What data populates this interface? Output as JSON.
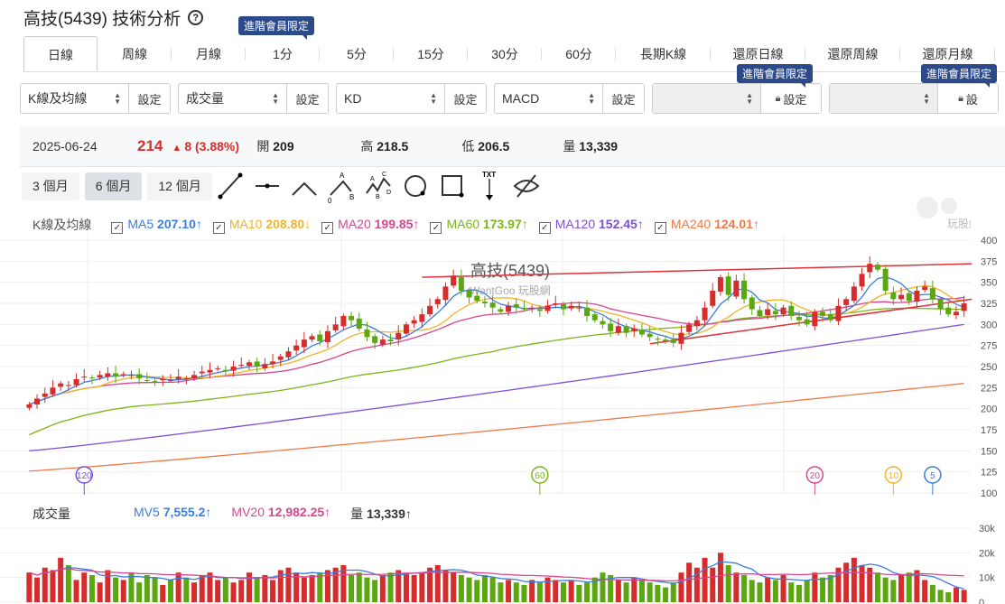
{
  "header": {
    "title": "高技(5439) 技術分析",
    "help_icon": "?"
  },
  "tabs": [
    "日線",
    "周線",
    "月線",
    "1分",
    "5分",
    "15分",
    "30分",
    "60分",
    "長期K線",
    "還原日線",
    "還原周線",
    "還原月線"
  ],
  "premium_badge": "進階會員限定",
  "selectors": [
    {
      "value": "K線及均線",
      "btn": "設定"
    },
    {
      "value": "成交量",
      "btn": "設定"
    },
    {
      "value": "KD",
      "btn": "設定"
    },
    {
      "value": "MACD",
      "btn": "設定"
    },
    {
      "value": "",
      "btn": "設定",
      "locked": true
    },
    {
      "value": "",
      "btn": "設",
      "locked": true
    }
  ],
  "info": {
    "date": "2025-06-24",
    "price": "214",
    "change": "8 (3.88%)",
    "open_label": "開",
    "open": "209",
    "high_label": "高",
    "high": "218.5",
    "low_label": "低",
    "low": "206.5",
    "vol_label": "量",
    "vol": "13,339"
  },
  "ranges": [
    "3 個月",
    "6 個月",
    "12 個月"
  ],
  "drawing_tools": [
    "line-tool",
    "horizontal-line-tool",
    "angle-tool",
    "abc-wave-tool",
    "abcd-wave-tool",
    "circle-tool",
    "rectangle-tool",
    "text-tool",
    "hide-tool"
  ],
  "ma_legend": {
    "label": "K線及均線",
    "items": [
      {
        "name": "MA5",
        "value": "207.10↑",
        "color": "#3b7ddd"
      },
      {
        "name": "MA10",
        "value": "208.80↓",
        "color": "#f0b429"
      },
      {
        "name": "MA20",
        "value": "199.85↑",
        "color": "#d6478f"
      },
      {
        "name": "MA60",
        "value": "173.97↑",
        "color": "#7cb518"
      },
      {
        "name": "MA120",
        "value": "152.45↑",
        "color": "#7b4fd6"
      },
      {
        "name": "MA240",
        "value": "124.01↑",
        "color": "#ec7a4a"
      }
    ]
  },
  "watermark": {
    "title": "高技(5439)",
    "sub": "WantGoo 玩股網",
    "logo": "玩股網"
  },
  "price_axis": {
    "min": 100,
    "max": 400,
    "ticks": [
      400,
      375,
      350,
      325,
      300,
      275,
      250,
      225,
      200,
      175,
      150,
      125,
      100
    ]
  },
  "ma_markers": [
    {
      "label": "120",
      "color": "#7b4fd6",
      "index": 7
    },
    {
      "label": "60",
      "color": "#7cb518",
      "index": 65
    },
    {
      "label": "20",
      "color": "#d6478f",
      "index": 100
    },
    {
      "label": "10",
      "color": "#f0b429",
      "index": 110
    },
    {
      "label": "5",
      "color": "#3b7ddd",
      "index": 115
    }
  ],
  "closes": [
    205,
    212,
    218,
    225,
    230,
    228,
    235,
    238,
    236,
    240,
    242,
    238,
    241,
    240,
    236,
    233,
    232,
    235,
    234,
    238,
    236,
    240,
    244,
    246,
    248,
    245,
    250,
    252,
    255,
    250,
    253,
    256,
    262,
    268,
    275,
    282,
    286,
    280,
    292,
    300,
    310,
    305,
    295,
    285,
    278,
    282,
    280,
    290,
    300,
    305,
    312,
    322,
    330,
    345,
    358,
    340,
    332,
    328,
    325,
    320,
    315,
    322,
    320,
    318,
    320,
    316,
    322,
    325,
    318,
    322,
    320,
    310,
    305,
    300,
    292,
    298,
    290,
    295,
    288,
    285,
    282,
    280,
    278,
    290,
    300,
    305,
    320,
    340,
    356,
    335,
    352,
    330,
    318,
    310,
    318,
    312,
    320,
    310,
    305,
    300,
    315,
    310,
    305,
    322,
    330,
    345,
    360,
    372,
    365,
    340,
    330,
    335,
    328,
    340,
    345,
    330,
    318,
    312,
    315,
    325
  ],
  "ma120_range": [
    150,
    300
  ],
  "ma240_range": [
    126,
    230
  ],
  "trend_lines": [
    {
      "from": [
        50,
        356
      ],
      "to": [
        120,
        372
      ]
    },
    {
      "from": [
        79,
        277
      ],
      "to": [
        120,
        330
      ]
    }
  ],
  "volume": {
    "label": "成交量",
    "mv5_label": "MV5",
    "mv5": "7,555.2↑",
    "mv20_label": "MV20",
    "mv20": "12,982.25↑",
    "vol_label": "量",
    "vol": "13,339↑",
    "ticks": [
      "30k",
      "20k",
      "10k",
      "0"
    ],
    "values": [
      12,
      10,
      14,
      13,
      18,
      15,
      9,
      12,
      11,
      8,
      13,
      10,
      9,
      12,
      8,
      11,
      10,
      7,
      9,
      12,
      10,
      8,
      11,
      12,
      9,
      10,
      8,
      9,
      12,
      10,
      11,
      9,
      13,
      14,
      12,
      10,
      11,
      12,
      13,
      14,
      15,
      11,
      12,
      10,
      9,
      11,
      12,
      13,
      12,
      11,
      12,
      14,
      15,
      13,
      12,
      11,
      10,
      9,
      11,
      10,
      8,
      9,
      8,
      7,
      9,
      8,
      10,
      9,
      8,
      9,
      7,
      8,
      10,
      12,
      11,
      9,
      8,
      10,
      9,
      8,
      7,
      6,
      8,
      12,
      16,
      14,
      18,
      14,
      20,
      15,
      12,
      11,
      9,
      8,
      10,
      9,
      11,
      8,
      7,
      9,
      12,
      10,
      11,
      14,
      16,
      18,
      15,
      14,
      12,
      10,
      9,
      11,
      12,
      13,
      9,
      7,
      5,
      4,
      6,
      5
    ]
  }
}
